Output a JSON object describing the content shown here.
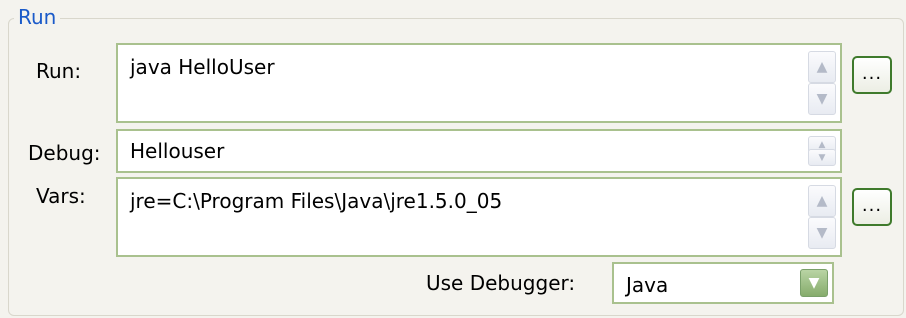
{
  "group": {
    "title": "Run"
  },
  "run": {
    "label": "Run:",
    "value": "java HelloUser",
    "browse_label": "..."
  },
  "debug": {
    "label": "Debug:",
    "value": "Hellouser"
  },
  "vars": {
    "label": "Vars:",
    "value": "jre=C:\\Program Files\\Java\\jre1.5.0_05",
    "browse_label": "..."
  },
  "debugger": {
    "label": "Use Debugger:",
    "selected": "Java"
  },
  "icons": {
    "scroll_up": "chevron-up-icon",
    "scroll_down": "chevron-down-icon",
    "dropdown": "chevron-down-icon"
  },
  "colors": {
    "legend_text": "#1a5ac9",
    "field_border": "#a9c18e",
    "button_border": "#3f7a2c"
  }
}
